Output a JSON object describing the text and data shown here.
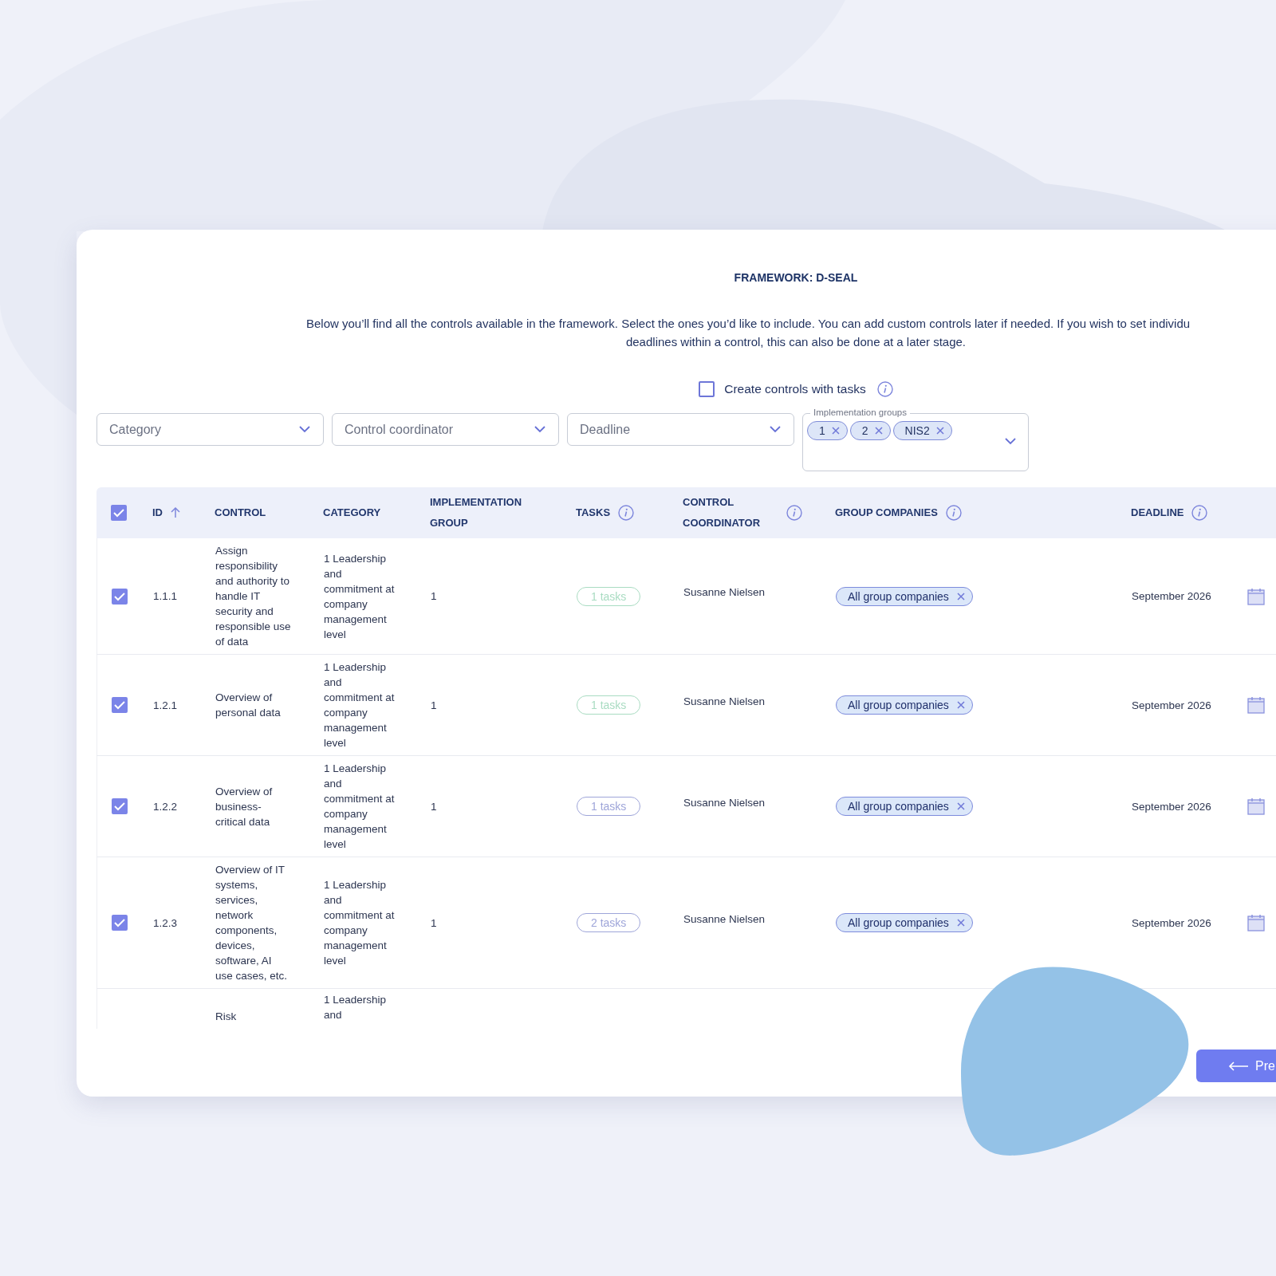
{
  "title": "FRAMEWORK: D-SEAL",
  "description_lines": [
    "Below you’ll find all the controls available in the framework. Select the ones you’d like to include. You can add custom controls later if needed. If you wish to set individu",
    "deadlines within a control, this can also be done at a later stage."
  ],
  "tasks_option": {
    "label": "Create controls with tasks",
    "checked": false
  },
  "filters": [
    {
      "kind": "select",
      "placeholder": "Category"
    },
    {
      "kind": "select",
      "placeholder": "Control coordinator"
    },
    {
      "kind": "select",
      "placeholder": "Deadline"
    },
    {
      "kind": "multiselect",
      "label": "Implementation groups",
      "chips": [
        "1",
        "2",
        "NIS2"
      ]
    }
  ],
  "table": {
    "all_selected": true,
    "columns": [
      {
        "label": "ID",
        "sorted": true
      },
      {
        "label": "CONTROL"
      },
      {
        "label": "CATEGORY"
      },
      {
        "label": "IMPLEMENTATION GROUP"
      },
      {
        "label": "TASKS",
        "info": true
      },
      {
        "label": "CONTROL COORDINATOR",
        "info": true
      },
      {
        "label": "GROUP COMPANIES",
        "info": true
      },
      {
        "label": "DEADLINE",
        "info": true
      }
    ],
    "rows": [
      {
        "kind": "full",
        "selected": true,
        "id": "1.1.1",
        "control": "Assign responsibility and authority to handle IT security and responsible use of data",
        "category": "1 Leadership and commitment at company management level",
        "group": "1",
        "tasks": {
          "label": "1 tasks",
          "color": "#a9dcc2"
        },
        "coordinator": "Susanne Nielsen",
        "companies": "All group companies",
        "deadline": "September 2026"
      },
      {
        "kind": "full",
        "selected": true,
        "id": "1.2.1",
        "control": "Overview of personal data",
        "category": "1 Leadership and commitment at company management level",
        "group": "1",
        "tasks": {
          "label": "1 tasks",
          "color": "#a9dcc2"
        },
        "coordinator": "Susanne Nielsen",
        "companies": "All group companies",
        "deadline": "September 2026"
      },
      {
        "kind": "full",
        "selected": true,
        "id": "1.2.2",
        "control": "Overview of business-critical data",
        "category": "1 Leadership and commitment at company management level",
        "group": "1",
        "tasks": {
          "label": "1 tasks",
          "color": "#9ea5d9"
        },
        "coordinator": "Susanne Nielsen",
        "companies": "All group companies",
        "deadline": "September 2026"
      },
      {
        "kind": "full",
        "selected": true,
        "id": "1.2.3",
        "control": "Overview of IT systems, services, network components, devices, software, AI use cases, etc.",
        "category": "1 Leadership and commitment at company management level",
        "group": "1",
        "tasks": {
          "label": "2 tasks",
          "color": "#9ea5d9"
        },
        "coordinator": "Susanne Nielsen",
        "companies": "All group companies",
        "deadline": "September 2026"
      },
      {
        "kind": "partial",
        "control": "Risk",
        "category": "1 Leadership and"
      }
    ]
  },
  "button": {
    "label": "Pre"
  }
}
